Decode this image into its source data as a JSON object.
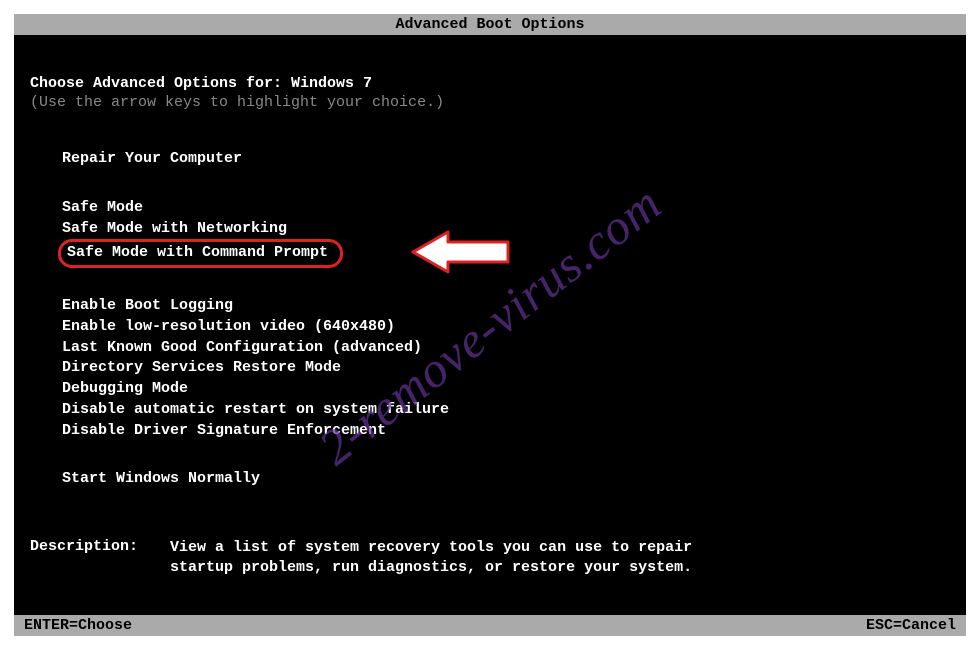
{
  "title": "Advanced Boot Options",
  "prompt": {
    "prefix": "Choose Advanced Options for: ",
    "os": "Windows 7",
    "hint": "(Use the arrow keys to highlight your choice.)"
  },
  "menu": {
    "group1": [
      "Repair Your Computer"
    ],
    "group2": [
      "Safe Mode",
      "Safe Mode with Networking",
      "Safe Mode with Command Prompt"
    ],
    "group3": [
      "Enable Boot Logging",
      "Enable low-resolution video (640x480)",
      "Last Known Good Configuration (advanced)",
      "Directory Services Restore Mode",
      "Debugging Mode",
      "Disable automatic restart on system failure",
      "Disable Driver Signature Enforcement"
    ],
    "group4": [
      "Start Windows Normally"
    ],
    "highlighted_index": 2
  },
  "description": {
    "label": "Description:",
    "text": "View a list of system recovery tools you can use to repair startup problems, run diagnostics, or restore your system."
  },
  "footer": {
    "left": "ENTER=Choose",
    "right": "ESC=Cancel"
  },
  "watermark": "2-remove-virus.com",
  "annotation": {
    "arrow_icon": "arrow-left-icon",
    "highlight_color": "#d22"
  }
}
